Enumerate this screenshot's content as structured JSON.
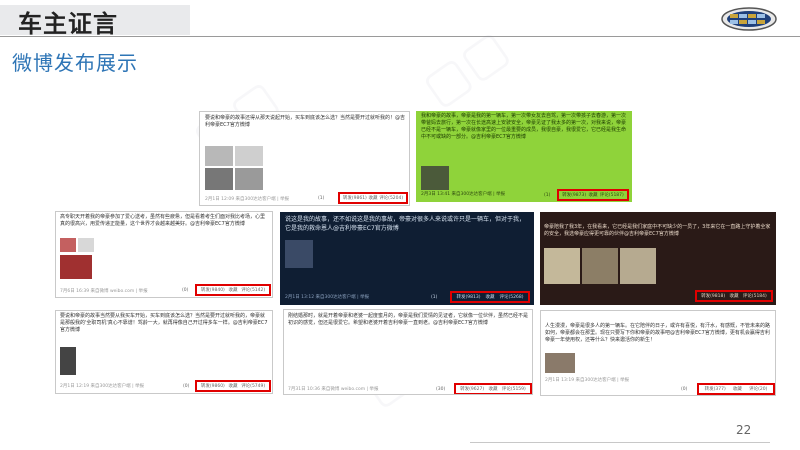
{
  "header": {
    "title": "车主证言",
    "page_number": "22"
  },
  "section": {
    "title": "微博发布展示"
  },
  "colors": {
    "accent_blue": "#2e75b6",
    "highlight_red": "#e00000",
    "green_post": "#8fd33a",
    "dark_navy_post": "#0f1e33",
    "dark_brown_post": "#2a1a17"
  },
  "icons": {
    "logo": "geely-logo-icon"
  },
  "posts": [
    {
      "text": "要说和帝豪的故事还得从那天说起开始，买车到底该怎么选？当然是要开过就听我的！@吉利帝豪EC7官方微博",
      "meta": "2月1日 12:09  来自300达达客户端 | 举报",
      "likes": "(1)",
      "forward": "转发(9861)",
      "favorite": "收藏",
      "comment": "评论(5204)"
    },
    {
      "text": "我和帝豪的故事，帝豪是我的第一辆车，第一次带女友去自驾，第一次带孩子去春游，第一次带爸妈去旅行，第一次在长途高速上安驶安全，帝豪见证了我太多的第一次，对我来说，帝豪已经不是一辆车，帝豪就像家里的一位最重要的成员，我很自豪，我很爱它，它已经是我生命中不可或缺的一部分。@吉利帝豪EC7官方微博",
      "meta": "2月3日 13:41  来自300达达客户端 | 举报",
      "likes": "(1)",
      "forward": "转发(9873)",
      "favorite": "收藏",
      "comment": "评论(5187)"
    },
    {
      "text": "高专职天开着我的帝豪参加了爱心送考，虽然有些疲惫，但是看着考生们面对我比考场，心里真的很高兴，用爱传递正能量，这个世界才会越来越美好。@吉利帝豪EC7官方微博",
      "meta": "7月6日 16:39  来自微博 weibo.com | 举报",
      "likes": "(0)",
      "forward": "转发(9840)",
      "favorite": "收藏",
      "comment": "评论(5142)"
    },
    {
      "text": "说这是我的故事，还不如说这是我的事故，帝豪对很多人来说或许只是一辆车，但对于我，它是我的救命恩人@吉利帝豪EC7官方微博",
      "meta": "2月1日 13:12  来自300达达客户端 | 举报",
      "likes": "(1)",
      "forward": "转发(9813)",
      "favorite": "收藏",
      "comment": "评论(5268)"
    },
    {
      "text": "帝豪陪我了我3年，在我看来，它已经是我们家庭中不可缺少的一员了，3年来它在一直路上守护着全家的安全，我选帝豪应得更可靠的伙伴@吉利帝豪EC7官方微博",
      "meta": "",
      "likes": "",
      "forward": "转发(9818)",
      "favorite": "收藏",
      "comment": "评论(5184)"
    },
    {
      "text": "要说和帝豪的故事当然要从我买车开始，买车到底该怎么选？当然是要开过就听我的，帝豪就是那般我的'全职司机'真心不靠谱！驾龄一大，就再得像自己开过得多车一样。@吉利帝豪EC7官方微博",
      "meta": "2月1日 12:19  来自300达达客户端 | 举报",
      "likes": "(0)",
      "forward": "转发(9860)",
      "favorite": "收藏",
      "comment": "评论(5749)"
    },
    {
      "text": "刚结婚那时，就是开着帝豪和老婆一起度蜜月的，帝豪是我们爱情的见证者，它就像一位伙伴，虽然已经不是初识的感觉，但还是很爱它。希望和老婆开着吉利帝豪一直到老。@吉利帝豪EC7官方微博",
      "meta": "7月31日 10:36  来自微博 weibo.com | 举报",
      "likes": "(30)",
      "forward": "转发(9627)",
      "favorite": "收藏",
      "comment": "评论(5159)"
    },
    {
      "text": "人生漫漫，帝豪是很多人的第一辆车。在它陪伴的日子，或许有喜悦，有汗水，有感慨，不管未来的路如何，帝豪都会在那里。现在只要写下你和帝豪的故事吧@吉利帝豪EC7官方微博，更有机会赢得吉利帝豪一年使用权，还等什么？快来邀活你的新生！",
      "meta": "2月1日 13:19  来自300达达客户端 | 举报",
      "likes": "(0)",
      "forward": "转发(377)",
      "favorite": "收藏",
      "comment": "评论(20)"
    }
  ]
}
